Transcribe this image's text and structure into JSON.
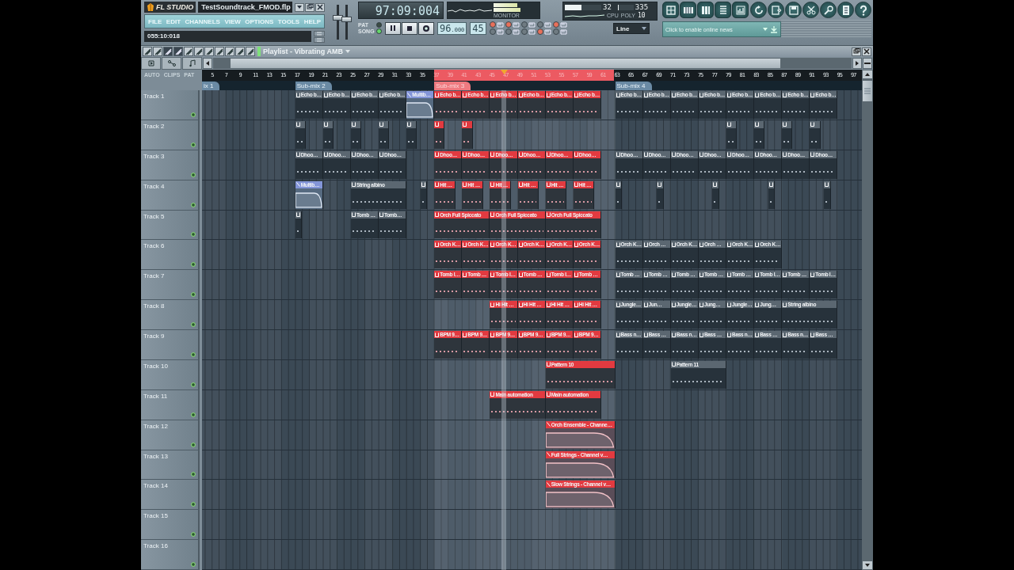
{
  "app": {
    "logo": "FL STUDIO",
    "project_title": "TestSoundtrack_FMOD.flp",
    "menu": [
      "FILE",
      "EDIT",
      "CHANNELS",
      "VIEW",
      "OPTIONS",
      "TOOLS",
      "HELP"
    ],
    "hint": "055:10:018"
  },
  "master_sliders": [
    {
      "level": 0.62
    },
    {
      "level": 0.55
    }
  ],
  "transport": {
    "modes": [
      {
        "label": "PAT",
        "selected": false
      },
      {
        "label": "SONG",
        "selected": true
      }
    ],
    "song_time": "97:09:004",
    "tempo": "96",
    "tempo_fraction": ".000",
    "pattern": "45",
    "monitor_label": "MONITOR"
  },
  "record_toggles": [
    {
      "on": true
    },
    {
      "on": true
    },
    {
      "on": false
    },
    {
      "on": false
    },
    {
      "on": true
    },
    {
      "on": false
    },
    {
      "on": false
    },
    {
      "on": false
    },
    {
      "on": true
    },
    {
      "on": false
    }
  ],
  "cpu": {
    "value": "32",
    "level": 0.45,
    "memory": {
      "value": "335",
      "level": 0.08
    },
    "poly": "10",
    "labels": [
      "CPU",
      "POLY"
    ]
  },
  "snap": "Line",
  "news": "Click to enable online news",
  "playlist": {
    "title": "Playlist - Vibrating AMB",
    "header_labels": [
      "AUTO",
      "CLIPS",
      "PAT"
    ],
    "ruler": [
      "5",
      "7",
      "9",
      "11",
      "13",
      "15",
      "17",
      "19",
      "21",
      "23",
      "25",
      "27",
      "29",
      "31",
      "33",
      "35",
      "37",
      "39",
      "41",
      "43",
      "45",
      "47",
      "49",
      "51",
      "53",
      "55",
      "57",
      "59",
      "61",
      "63",
      "65",
      "67",
      "69",
      "71",
      "73",
      "75",
      "77",
      "79",
      "81",
      "83",
      "85",
      "87",
      "89",
      "91",
      "93",
      "95",
      "97"
    ],
    "markers": [
      {
        "label": "ix 1"
      },
      {
        "label": "Sub-mix 2"
      },
      {
        "label": "Sub-mix 3"
      },
      {
        "label": "Sub-mix 4"
      }
    ],
    "tracks": [
      {
        "name": "Track 1",
        "clips": [
          {
            "kind": "pattern",
            "name": "Echo b…",
            "selected": false
          },
          {
            "kind": "pattern",
            "name": "Echo b…",
            "selected": false
          },
          {
            "kind": "pattern",
            "name": "Echo b…",
            "selected": false
          },
          {
            "kind": "pattern",
            "name": "Echo b…",
            "selected": false
          },
          {
            "kind": "automation",
            "name": "Multib…",
            "selected": false
          },
          {
            "kind": "pattern",
            "name": "Echo b…",
            "selected": true
          },
          {
            "kind": "pattern",
            "name": "Echo b…",
            "selected": true
          },
          {
            "kind": "pattern",
            "name": "Echo b…",
            "selected": true
          },
          {
            "kind": "pattern",
            "name": "Echo b…",
            "selected": true
          },
          {
            "kind": "pattern",
            "name": "Echo b…",
            "selected": true
          },
          {
            "kind": "pattern",
            "name": "Echo b…",
            "selected": true
          },
          {
            "kind": "pattern",
            "name": "Echo b…",
            "selected": false
          },
          {
            "kind": "pattern",
            "name": "Echo b…",
            "selected": false
          },
          {
            "kind": "pattern",
            "name": "Echo b…",
            "selected": false
          },
          {
            "kind": "pattern",
            "name": "Echo b…",
            "selected": false
          },
          {
            "kind": "pattern",
            "name": "Echo b…",
            "selected": false
          },
          {
            "kind": "pattern",
            "name": "Echo b…",
            "selected": false
          },
          {
            "kind": "pattern",
            "name": "Echo b…",
            "selected": false
          },
          {
            "kind": "pattern",
            "name": "Echo b…",
            "selected": false
          }
        ]
      },
      {
        "name": "Track 2",
        "clips": [
          {
            "kind": "pattern",
            "selected": false
          },
          {
            "kind": "pattern",
            "selected": false
          },
          {
            "kind": "pattern",
            "selected": false
          },
          {
            "kind": "pattern",
            "selected": false
          },
          {
            "kind": "pattern",
            "selected": false
          },
          {
            "kind": "pattern",
            "selected": true
          },
          {
            "kind": "pattern",
            "selected": true
          },
          {
            "kind": "pattern",
            "selected": false
          },
          {
            "kind": "pattern",
            "selected": false
          },
          {
            "kind": "pattern",
            "selected": false
          },
          {
            "kind": "pattern",
            "selected": false
          }
        ]
      },
      {
        "name": "Track 3",
        "clips": [
          {
            "kind": "pattern",
            "name": "Dhoo…",
            "selected": false
          },
          {
            "kind": "pattern",
            "name": "Dhoo…",
            "selected": false
          },
          {
            "kind": "pattern",
            "name": "Dhoo…",
            "selected": false
          },
          {
            "kind": "pattern",
            "name": "Dhoo…",
            "selected": false
          },
          {
            "kind": "pattern",
            "name": "Dhoo…",
            "selected": true
          },
          {
            "kind": "pattern",
            "name": "Dhoo…",
            "selected": true
          },
          {
            "kind": "pattern",
            "name": "Dhoo…",
            "selected": true
          },
          {
            "kind": "pattern",
            "name": "Dhoo…",
            "selected": true
          },
          {
            "kind": "pattern",
            "name": "Dhoo…",
            "selected": true
          },
          {
            "kind": "pattern",
            "name": "Dhoo…",
            "selected": true
          },
          {
            "kind": "pattern",
            "name": "Dhoo…",
            "selected": false
          },
          {
            "kind": "pattern",
            "name": "Dhoo…",
            "selected": false
          },
          {
            "kind": "pattern",
            "name": "Dhoo…",
            "selected": false
          },
          {
            "kind": "pattern",
            "name": "Dhoo…",
            "selected": false
          },
          {
            "kind": "pattern",
            "name": "Dhoo…",
            "selected": false
          },
          {
            "kind": "pattern",
            "name": "Dhoo…",
            "selected": false
          },
          {
            "kind": "pattern",
            "name": "Dhoo…",
            "selected": false
          },
          {
            "kind": "pattern",
            "name": "Dhoo…",
            "selected": false
          }
        ]
      },
      {
        "name": "Track 4",
        "clips": [
          {
            "kind": "automation",
            "name": "Multib…",
            "selected": false
          },
          {
            "kind": "pattern",
            "name": "String albino",
            "selected": false
          },
          {
            "kind": "pattern",
            "selected": false
          },
          {
            "kind": "pattern",
            "name": "Hit …",
            "selected": true
          },
          {
            "kind": "pattern",
            "name": "Hit …",
            "selected": true
          },
          {
            "kind": "pattern",
            "name": "Hit …",
            "selected": true
          },
          {
            "kind": "pattern",
            "name": "Hit …",
            "selected": true
          },
          {
            "kind": "pattern",
            "name": "Hit …",
            "selected": true
          },
          {
            "kind": "pattern",
            "name": "Hit …",
            "selected": true
          },
          {
            "kind": "pattern",
            "selected": false
          },
          {
            "kind": "pattern",
            "selected": false
          },
          {
            "kind": "pattern",
            "selected": false
          },
          {
            "kind": "pattern",
            "selected": false
          },
          {
            "kind": "pattern",
            "selected": false
          }
        ]
      },
      {
        "name": "Track 5",
        "clips": [
          {
            "kind": "pattern",
            "selected": false
          },
          {
            "kind": "pattern",
            "name": "Tomb …",
            "selected": false
          },
          {
            "kind": "pattern",
            "name": "Tomb…",
            "selected": false
          },
          {
            "kind": "pattern",
            "name": "Orch Full Spiccato",
            "selected": true
          },
          {
            "kind": "pattern",
            "name": "Orch Full Spiccato",
            "selected": true
          },
          {
            "kind": "pattern",
            "name": "Orch Full Spiccato",
            "selected": true
          }
        ]
      },
      {
        "name": "Track 6",
        "clips": [
          {
            "kind": "pattern",
            "name": "Orch K…",
            "selected": true
          },
          {
            "kind": "pattern",
            "name": "Orch K…",
            "selected": true
          },
          {
            "kind": "pattern",
            "name": "Orch K…",
            "selected": true
          },
          {
            "kind": "pattern",
            "name": "Orch K…",
            "selected": true
          },
          {
            "kind": "pattern",
            "name": "Orch K…",
            "selected": true
          },
          {
            "kind": "pattern",
            "name": "Orch K…",
            "selected": true
          },
          {
            "kind": "pattern",
            "name": "Orch K…",
            "selected": false
          },
          {
            "kind": "pattern",
            "name": "Orch …",
            "selected": false
          },
          {
            "kind": "pattern",
            "name": "Orch K…",
            "selected": false
          },
          {
            "kind": "pattern",
            "name": "Orch …",
            "selected": false
          },
          {
            "kind": "pattern",
            "name": "Orch K…",
            "selected": false
          },
          {
            "kind": "pattern",
            "name": "Orch K…",
            "selected": false
          }
        ]
      },
      {
        "name": "Track 7",
        "clips": [
          {
            "kind": "pattern",
            "name": "Tomb I…",
            "selected": true
          },
          {
            "kind": "pattern",
            "name": "Tomb …",
            "selected": true
          },
          {
            "kind": "pattern",
            "name": "Tomb I…",
            "selected": true
          },
          {
            "kind": "pattern",
            "name": "Tomb …",
            "selected": true
          },
          {
            "kind": "pattern",
            "name": "Tomb I…",
            "selected": true
          },
          {
            "kind": "pattern",
            "name": "Tomb …",
            "selected": true
          },
          {
            "kind": "pattern",
            "name": "Tomb …",
            "selected": false
          },
          {
            "kind": "pattern",
            "name": "Tomb …",
            "selected": false
          },
          {
            "kind": "pattern",
            "name": "Tomb …",
            "selected": false
          },
          {
            "kind": "pattern",
            "name": "Tomb …",
            "selected": false
          },
          {
            "kind": "pattern",
            "name": "Tomb …",
            "selected": false
          },
          {
            "kind": "pattern",
            "name": "Tomb I…",
            "selected": false
          },
          {
            "kind": "pattern",
            "name": "Tomb …",
            "selected": false
          },
          {
            "kind": "pattern",
            "name": "Tomb I…",
            "selected": false
          }
        ]
      },
      {
        "name": "Track 8",
        "clips": [
          {
            "kind": "pattern",
            "name": "Hi Hit …",
            "selected": true
          },
          {
            "kind": "pattern",
            "name": "Hi Hit …",
            "selected": true
          },
          {
            "kind": "pattern",
            "name": "Hi Hit …",
            "selected": true
          },
          {
            "kind": "pattern",
            "name": "Hi Hit …",
            "selected": true
          },
          {
            "kind": "pattern",
            "name": "Jungle…",
            "selected": false
          },
          {
            "kind": "pattern",
            "name": "Jun…",
            "selected": false
          },
          {
            "kind": "pattern",
            "name": "Jungle…",
            "selected": false
          },
          {
            "kind": "pattern",
            "name": "Jung…",
            "selected": false
          },
          {
            "kind": "pattern",
            "name": "Jungle…",
            "selected": false
          },
          {
            "kind": "pattern",
            "name": "Jung…",
            "selected": false
          },
          {
            "kind": "pattern",
            "name": "String albino",
            "selected": false
          }
        ]
      },
      {
        "name": "Track 9",
        "clips": [
          {
            "kind": "pattern",
            "name": "BPM 9…",
            "selected": true
          },
          {
            "kind": "pattern",
            "name": "BPM 9…",
            "selected": true
          },
          {
            "kind": "pattern",
            "name": "BPM 9…",
            "selected": true
          },
          {
            "kind": "pattern",
            "name": "BPM 9…",
            "selected": true
          },
          {
            "kind": "pattern",
            "name": "BPM 9…",
            "selected": true
          },
          {
            "kind": "pattern",
            "name": "BPM 9…",
            "selected": true
          },
          {
            "kind": "pattern",
            "name": "Bass n…",
            "selected": false
          },
          {
            "kind": "pattern",
            "name": "Bass …",
            "selected": false
          },
          {
            "kind": "pattern",
            "name": "Bass n…",
            "selected": false
          },
          {
            "kind": "pattern",
            "name": "Bass …",
            "selected": false
          },
          {
            "kind": "pattern",
            "name": "Bass n…",
            "selected": false
          },
          {
            "kind": "pattern",
            "name": "Bass …",
            "selected": false
          },
          {
            "kind": "pattern",
            "name": "Bass n…",
            "selected": false
          },
          {
            "kind": "pattern",
            "name": "Bass …",
            "selected": false
          }
        ]
      },
      {
        "name": "Track 10",
        "clips": [
          {
            "kind": "pattern",
            "name": "Pattern 10",
            "selected": true
          },
          {
            "kind": "pattern",
            "name": "Pattern 11",
            "selected": false
          }
        ]
      },
      {
        "name": "Track 11",
        "clips": [
          {
            "kind": "pattern",
            "name": "Main automation",
            "selected": true
          },
          {
            "kind": "pattern",
            "name": "Main automation",
            "selected": true
          }
        ]
      },
      {
        "name": "Track 12",
        "clips": [
          {
            "kind": "automation",
            "name": "Orch Ensemble - Channe…",
            "selected": true
          }
        ]
      },
      {
        "name": "Track 13",
        "clips": [
          {
            "kind": "automation",
            "name": "Full Strings - Channel v…",
            "selected": true
          }
        ]
      },
      {
        "name": "Track 14",
        "clips": [
          {
            "kind": "automation",
            "name": "Slow Strings - Channel v…",
            "selected": true
          }
        ]
      },
      {
        "name": "Track 15"
      },
      {
        "name": "Track 16"
      }
    ]
  }
}
